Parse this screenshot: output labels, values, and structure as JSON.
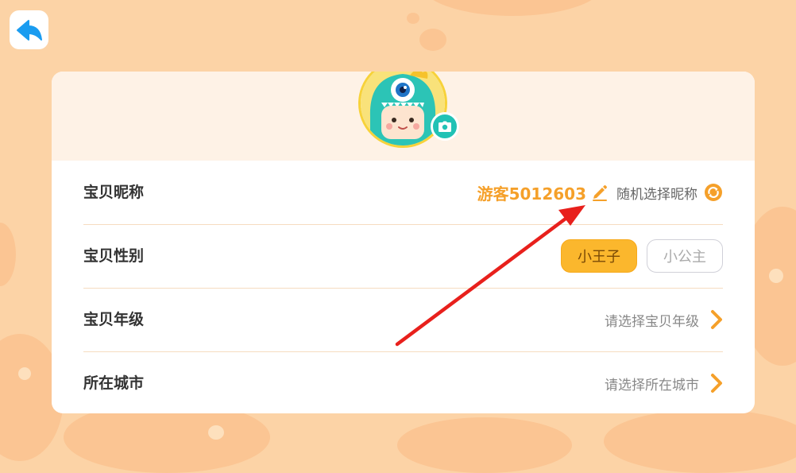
{
  "profile": {
    "nickname_label": "宝贝昵称",
    "nickname_value": "游客5012603",
    "random_nickname": "随机选择昵称",
    "gender_label": "宝贝性别",
    "gender_options": [
      "小王子",
      "小公主"
    ],
    "gender_selected": "小王子",
    "grade_label": "宝贝年级",
    "grade_placeholder": "请选择宝贝年级",
    "city_label": "所在城市",
    "city_placeholder": "请选择所在城市"
  },
  "icons": {
    "back": "back-arrow-icon",
    "camera": "camera-icon",
    "edit": "pencil-icon",
    "refresh": "refresh-icon",
    "chevron": "chevron-right-icon"
  },
  "colors": {
    "accent": "#f5a02a",
    "gender_active": "#fbb72d",
    "background": "#fcd3a6",
    "annotation": "#e8201c",
    "back_button": "#1a9cf0"
  }
}
